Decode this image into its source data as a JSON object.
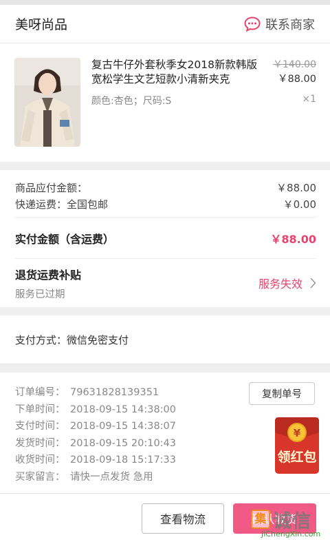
{
  "shop": {
    "name": "美呀尚品",
    "contact_label": "联系商家"
  },
  "product": {
    "title": "复古牛仔外套秋季女2018新款韩版宽松学生文艺短款小清新夹克",
    "attrs": "颜色:杏色；尺码:S",
    "original_price": "￥140.00",
    "price": "￥88.00",
    "quantity": "×1"
  },
  "fees": {
    "goods_label": "商品应付金额：",
    "goods_value": "￥88.00",
    "shipping_label": "快递运费：全国包邮",
    "shipping_value": "￥0.00",
    "paid_label": "实付金额（含运费）",
    "paid_value": "￥88.00"
  },
  "subsidy": {
    "title": "退货运费补贴",
    "note": "服务已过期",
    "status": "服务失效"
  },
  "payment": {
    "method": "支付方式：微信免密支付"
  },
  "order": {
    "copy_label": "复制单号",
    "lines": [
      {
        "k": "订单编号：",
        "v": "79631828139351"
      },
      {
        "k": "下单时间：",
        "v": "2018-09-15  14:38:00"
      },
      {
        "k": "支付时间：",
        "v": "2018-09-15  14:38:07"
      },
      {
        "k": "发货时间：",
        "v": "2018-09-15  20:10:43"
      },
      {
        "k": "收货时间：",
        "v": "2018-09-18  15:17:33"
      },
      {
        "k": "买家留言：",
        "v": "请快一点发货 急用"
      }
    ]
  },
  "redpacket_label": "领红包",
  "buttons": {
    "logistics": "查看物流",
    "confirm": "确认收货"
  },
  "watermark": {
    "box": "集",
    "text": "诚信",
    "url": "JiChengXin.com"
  },
  "colors": {
    "accent": "#e8436d",
    "button_pink": "#f05a85",
    "redpacket": "#d8362a"
  }
}
